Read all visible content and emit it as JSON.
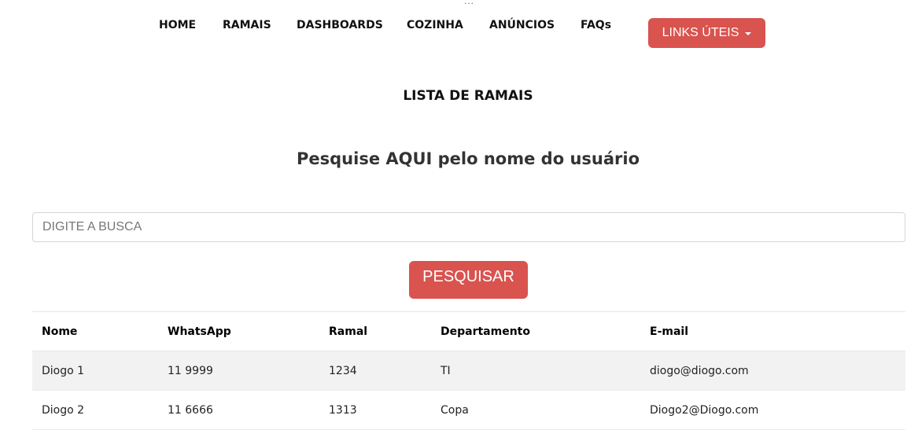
{
  "nav": {
    "items": [
      {
        "label": "HOME"
      },
      {
        "label": "RAMAIS"
      },
      {
        "label": "DASHBOARDS"
      },
      {
        "label": "COZINHA"
      },
      {
        "label": "ANÚNCIOS"
      },
      {
        "label": "FAQs"
      }
    ],
    "dropdown_label": "LINKS ÚTEIS",
    "overflow_indicator": "..."
  },
  "page": {
    "title": "LISTA DE RAMAIS",
    "search_heading": "Pesquise AQUI pelo nome do usuário"
  },
  "search": {
    "placeholder": "DIGITE A BUSCA",
    "value": "",
    "button_label": "PESQUISAR"
  },
  "table": {
    "headers": [
      "Nome",
      "WhatsApp",
      "Ramal",
      "Departamento",
      "E-mail"
    ],
    "rows": [
      [
        "Diogo 1",
        "11 9999",
        "1234",
        "TI",
        "diogo@diogo.com"
      ],
      [
        "Diogo 2",
        "11 6666",
        "1313",
        "Copa",
        "Diogo2@Diogo.com"
      ]
    ]
  },
  "colors": {
    "accent": "#d9534f",
    "striped_row": "#f2f2f2",
    "text": "#222222"
  }
}
